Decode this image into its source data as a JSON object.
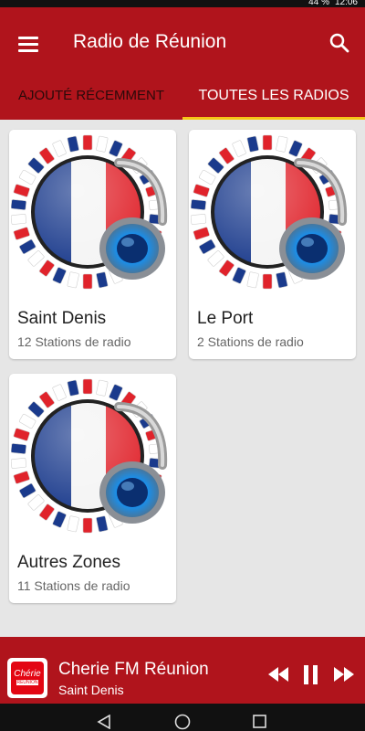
{
  "status": {
    "battery": "44 %",
    "time": "12:06"
  },
  "appbar": {
    "title": "Radio de Réunion",
    "menu_icon": "hamburger-icon",
    "search_icon": "search-icon"
  },
  "tabs": [
    {
      "label": "AJOUTÉ RÉCEMMENT",
      "active": false
    },
    {
      "label": "TOUTES LES RADIOS",
      "active": true
    }
  ],
  "cards": [
    {
      "name": "Saint Denis",
      "count": "12 Stations de radio"
    },
    {
      "name": "Le Port",
      "count": "2 Stations de radio"
    },
    {
      "name": "Autres Zones",
      "count": "11 Stations de radio"
    }
  ],
  "player": {
    "station": "Cherie FM Réunion",
    "subtitle": "Saint Denis",
    "logo_text_top": "Chérie",
    "logo_text_bottom": "RÉUNION"
  },
  "colors": {
    "brand": "#b0141c",
    "tab_indicator": "#f5c518"
  }
}
